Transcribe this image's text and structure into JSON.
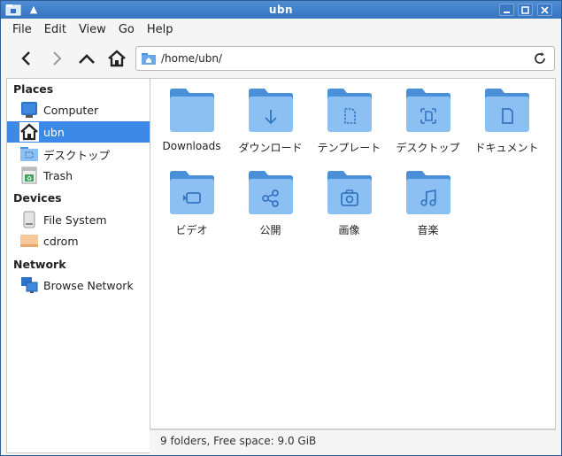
{
  "window": {
    "title": "ubn"
  },
  "menubar": {
    "items": [
      "File",
      "Edit",
      "View",
      "Go",
      "Help"
    ]
  },
  "location": {
    "path": "/home/ubn/"
  },
  "sidebar": {
    "places_heading": "Places",
    "places": [
      {
        "label": "Computer",
        "icon": "computer-icon"
      },
      {
        "label": "ubn",
        "icon": "home-icon",
        "active": true
      },
      {
        "label": "デスクトップ",
        "icon": "desktop-folder-icon"
      },
      {
        "label": "Trash",
        "icon": "trash-icon"
      }
    ],
    "devices_heading": "Devices",
    "devices": [
      {
        "label": "File System",
        "icon": "drive-icon"
      },
      {
        "label": "cdrom",
        "icon": "cdrom-icon"
      }
    ],
    "network_heading": "Network",
    "network": [
      {
        "label": "Browse Network",
        "icon": "network-icon"
      }
    ]
  },
  "folders": [
    {
      "label": "Downloads",
      "emblem": "none"
    },
    {
      "label": "ダウンロード",
      "emblem": "download"
    },
    {
      "label": "テンプレート",
      "emblem": "template"
    },
    {
      "label": "デスクトップ",
      "emblem": "desktop"
    },
    {
      "label": "ドキュメント",
      "emblem": "document"
    },
    {
      "label": "ビデオ",
      "emblem": "video"
    },
    {
      "label": "公開",
      "emblem": "share"
    },
    {
      "label": "画像",
      "emblem": "camera"
    },
    {
      "label": "音楽",
      "emblem": "music"
    }
  ],
  "status": {
    "text": "9 folders, Free space: 9.0 GiB"
  },
  "colors": {
    "accent": "#3c8ae6",
    "folder_front": "#8cc0f2",
    "folder_back": "#4a90d9",
    "titlebar": "#3574c0"
  }
}
